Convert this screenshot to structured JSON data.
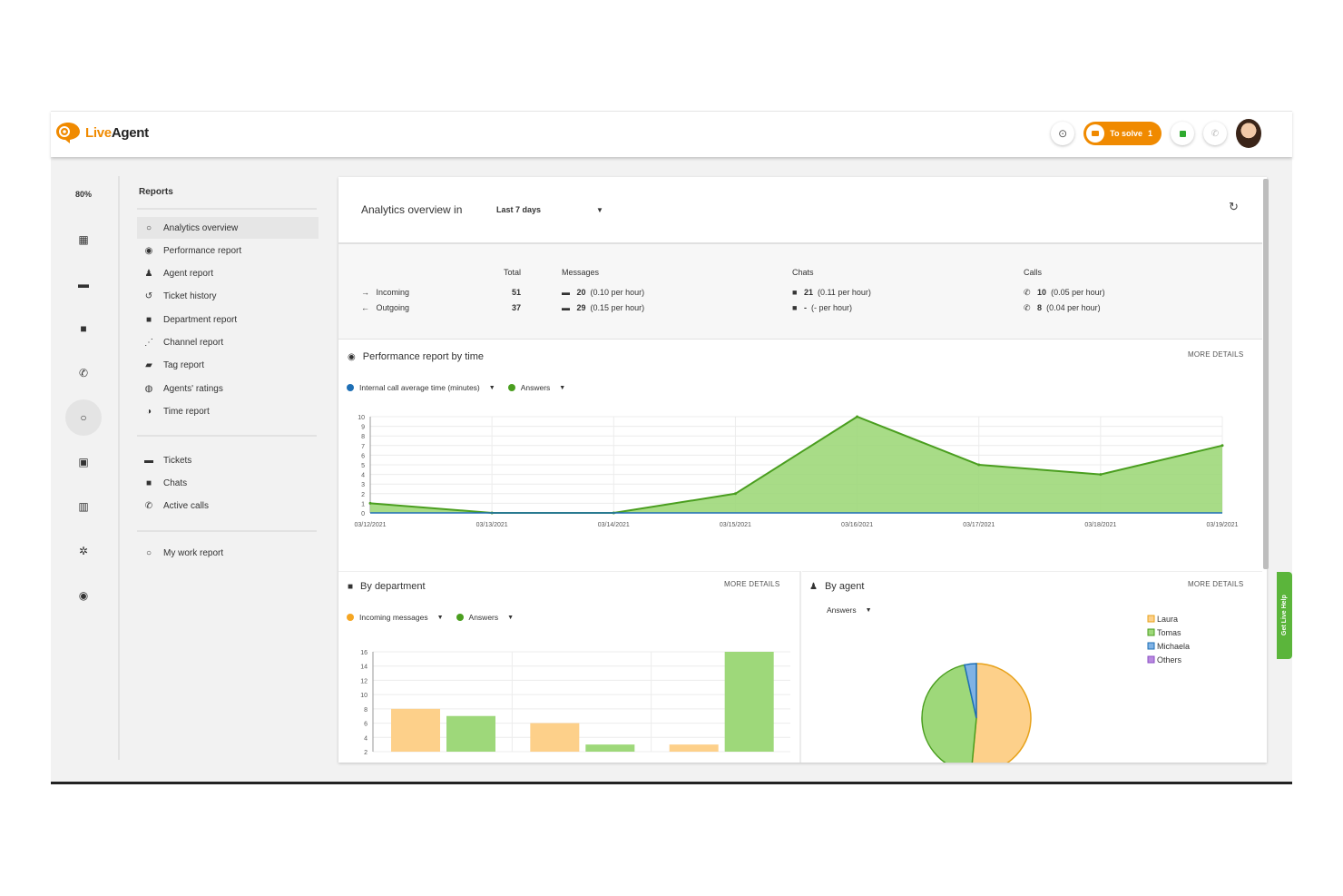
{
  "app": {
    "logo_live": "Live",
    "logo_agent": "Agent",
    "tosolve_label": "To solve",
    "tosolve_count": "1",
    "side_tab": "Get Live Help"
  },
  "rail": {
    "percent": "80%"
  },
  "nav": {
    "title": "Reports",
    "group1": [
      {
        "label": "Analytics overview",
        "icon": "circle-outline-icon",
        "active": true
      },
      {
        "label": "Performance report",
        "icon": "gauge-icon"
      },
      {
        "label": "Agent report",
        "icon": "person-icon"
      },
      {
        "label": "Ticket history",
        "icon": "history-icon"
      },
      {
        "label": "Department report",
        "icon": "folder-icon"
      },
      {
        "label": "Channel report",
        "icon": "rss-icon"
      },
      {
        "label": "Tag report",
        "icon": "tag-icon"
      },
      {
        "label": "Agents' ratings",
        "icon": "rating-icon"
      },
      {
        "label": "Time report",
        "icon": "clock-icon"
      }
    ],
    "group2": [
      {
        "label": "Tickets",
        "icon": "ticket-icon"
      },
      {
        "label": "Chats",
        "icon": "chat-icon"
      },
      {
        "label": "Active calls",
        "icon": "phone-icon"
      }
    ],
    "group3": [
      {
        "label": "My work report",
        "icon": "circle-outline-icon"
      }
    ]
  },
  "header": {
    "title": "Analytics overview in",
    "range": "Last 7 days"
  },
  "stats": {
    "col_total": "Total",
    "col_messages": "Messages",
    "col_chats": "Chats",
    "col_calls": "Calls",
    "incoming_label": "Incoming",
    "outgoing_label": "Outgoing",
    "incoming_total": "51",
    "outgoing_total": "37",
    "incoming_messages": "20",
    "incoming_messages_rate": "(0.10 per hour)",
    "outgoing_messages": "29",
    "outgoing_messages_rate": "(0.15 per hour)",
    "incoming_chats": "21",
    "incoming_chats_rate": "(0.11 per hour)",
    "outgoing_chats": "-",
    "outgoing_chats_rate": "(- per hour)",
    "incoming_calls": "10",
    "incoming_calls_rate": "(0.05 per hour)",
    "outgoing_calls": "8",
    "outgoing_calls_rate": "(0.04 per hour)"
  },
  "perf": {
    "title": "Performance report by time",
    "more": "MORE DETAILS",
    "legend1": "Internal call average time (minutes)",
    "legend2": "Answers"
  },
  "dept": {
    "title": "By department",
    "more": "MORE DETAILS",
    "legend1": "Incoming messages",
    "legend2": "Answers"
  },
  "agent": {
    "title": "By agent",
    "more": "MORE DETAILS",
    "select": "Answers"
  },
  "colors": {
    "brand": "#f08a00",
    "green": "#4a9e1f",
    "green_fill": "#9ed87a",
    "orange_fill": "#fdd08a",
    "blue": "#1e6fb5"
  },
  "chart_data": [
    {
      "type": "area",
      "title": "Performance report by time",
      "x": [
        "03/12/2021",
        "03/13/2021",
        "03/14/2021",
        "03/15/2021",
        "03/16/2021",
        "03/17/2021",
        "03/18/2021",
        "03/19/2021"
      ],
      "ylim": [
        0,
        10
      ],
      "yticks": [
        0,
        1,
        2,
        3,
        4,
        5,
        6,
        7,
        8,
        9,
        10
      ],
      "series": [
        {
          "name": "Internal call average time (minutes)",
          "values": [
            0,
            0,
            0,
            0,
            0,
            0,
            0,
            0
          ],
          "color": "#1e6fb5"
        },
        {
          "name": "Answers",
          "values": [
            1,
            0,
            0,
            2,
            10,
            5,
            4,
            7
          ],
          "color": "#4a9e1f"
        }
      ],
      "grid": true
    },
    {
      "type": "bar",
      "title": "By department",
      "categories": [
        "",
        "",
        ""
      ],
      "ylim": [
        2,
        16
      ],
      "yticks": [
        2,
        4,
        6,
        8,
        10,
        12,
        14,
        16
      ],
      "series": [
        {
          "name": "Incoming messages",
          "values": [
            8,
            6,
            3
          ],
          "color": "#fdd08a"
        },
        {
          "name": "Answers",
          "values": [
            7,
            3,
            16
          ],
          "color": "#9ed87a"
        }
      ],
      "grid": true
    },
    {
      "type": "pie",
      "title": "By agent",
      "labels": [
        "Laura",
        "Tomas",
        "Michaela",
        "Others"
      ],
      "values": [
        51.5,
        45,
        3.5,
        0
      ],
      "colors": [
        "#fdd08a",
        "#9ed87a",
        "#7fb2e5",
        "#b98ae0"
      ],
      "legend": "right"
    }
  ]
}
